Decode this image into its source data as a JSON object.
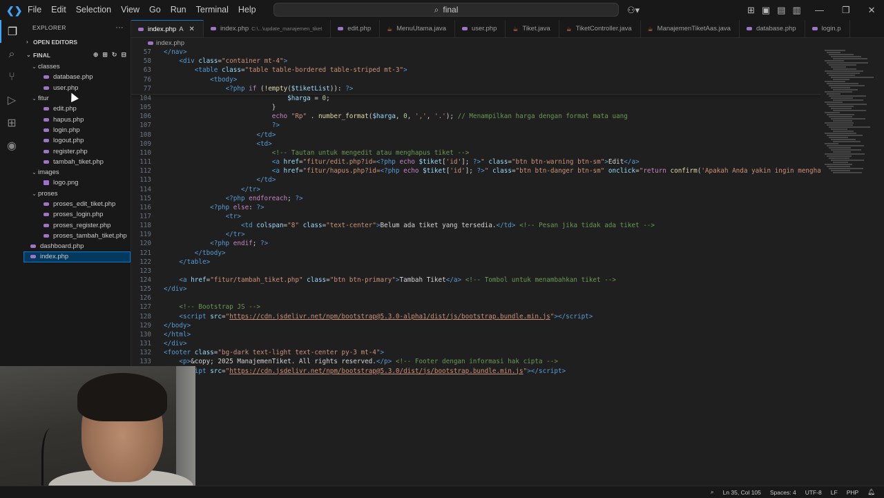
{
  "menu": [
    "File",
    "Edit",
    "Selection",
    "View",
    "Go",
    "Run",
    "Terminal",
    "Help"
  ],
  "search": {
    "text": "final"
  },
  "sidebar": {
    "header": "EXPLORER",
    "open_editors": "OPEN EDITORS",
    "folder": "FINAL",
    "tree": [
      {
        "label": "classes",
        "type": "folder",
        "depth": 1
      },
      {
        "label": "database.php",
        "type": "php",
        "depth": 2
      },
      {
        "label": "user.php",
        "type": "php",
        "depth": 2
      },
      {
        "label": "fitur",
        "type": "folder",
        "depth": 1
      },
      {
        "label": "edit.php",
        "type": "php",
        "depth": 2
      },
      {
        "label": "hapus.php",
        "type": "php",
        "depth": 2
      },
      {
        "label": "login.php",
        "type": "php",
        "depth": 2
      },
      {
        "label": "logout.php",
        "type": "php",
        "depth": 2
      },
      {
        "label": "register.php",
        "type": "php",
        "depth": 2
      },
      {
        "label": "tambah_tiket.php",
        "type": "php",
        "depth": 2
      },
      {
        "label": "images",
        "type": "folder",
        "depth": 1
      },
      {
        "label": "logo.png",
        "type": "img",
        "depth": 2
      },
      {
        "label": "proses",
        "type": "folder",
        "depth": 1
      },
      {
        "label": "proses_edit_tiket.php",
        "type": "php",
        "depth": 2
      },
      {
        "label": "proses_login.php",
        "type": "php",
        "depth": 2
      },
      {
        "label": "proses_register.php",
        "type": "php",
        "depth": 2
      },
      {
        "label": "proses_tambah_tiket.php",
        "type": "php",
        "depth": 2
      },
      {
        "label": "dashboard.php",
        "type": "php",
        "depth": 1
      },
      {
        "label": "index.php",
        "type": "php",
        "depth": 1,
        "selected": true
      }
    ]
  },
  "tabs": [
    {
      "label": "index.php",
      "modified": "A",
      "type": "php",
      "active": true
    },
    {
      "label": "index.php",
      "desc": "C:\\...\\update_manajemen_tiket",
      "type": "php"
    },
    {
      "label": "edit.php",
      "type": "php"
    },
    {
      "label": "MenuUtama.java",
      "type": "java"
    },
    {
      "label": "user.php",
      "type": "php"
    },
    {
      "label": "Tiket.java",
      "type": "java"
    },
    {
      "label": "TiketController.java",
      "type": "java"
    },
    {
      "label": "ManajemenTiketAas.java",
      "type": "java"
    },
    {
      "label": "database.php",
      "type": "php"
    },
    {
      "label": "login.p",
      "type": "php"
    }
  ],
  "breadcrumb": "index.php",
  "sticky_lines": [
    {
      "n": "57",
      "html": "<span class='t-tag'>&lt;/nav&gt;</span>"
    },
    {
      "n": "58",
      "html": "    <span class='t-tag'>&lt;div</span> <span class='t-attr'>class</span>=<span class='t-str'>\"container mt-4\"</span><span class='t-tag'>&gt;</span>"
    },
    {
      "n": "63",
      "html": "        <span class='t-tag'>&lt;table</span> <span class='t-attr'>class</span>=<span class='t-str'>\"table table-bordered table-striped mt-3\"</span><span class='t-tag'>&gt;</span>"
    },
    {
      "n": "76",
      "html": "            <span class='t-tag'>&lt;tbody&gt;</span>"
    },
    {
      "n": "77",
      "html": "                <span class='t-php'>&lt;?php</span> <span class='t-kw'>if</span> <span class='t-txt'>(!</span><span class='t-fn'>empty</span><span class='t-txt'>(</span><span class='t-var'>$tiketList</span><span class='t-txt'>)):</span> <span class='t-php'>?&gt;</span>"
    }
  ],
  "code_lines": [
    {
      "n": "104",
      "html": "                                <span class='t-var'>$harga</span> <span class='t-txt'>=</span> <span class='t-num'>0</span><span class='t-txt'>;</span>"
    },
    {
      "n": "105",
      "html": "                            <span class='t-txt'>}</span>"
    },
    {
      "n": "106",
      "html": "                            <span class='t-kw'>echo</span> <span class='t-str'>\"Rp\"</span> <span class='t-txt'>.</span> <span class='t-fn'>number_format</span><span class='t-txt'>(</span><span class='t-var'>$harga</span><span class='t-txt'>,</span> <span class='t-num'>0</span><span class='t-txt'>,</span> <span class='t-str'>','</span><span class='t-txt'>,</span> <span class='t-str'>'.'</span><span class='t-txt'>);</span> <span class='t-cmt'>// Menampilkan harga dengan format mata uang</span>"
    },
    {
      "n": "107",
      "html": "                            <span class='t-php'>?&gt;</span>"
    },
    {
      "n": "108",
      "html": "                        <span class='t-tag'>&lt;/td&gt;</span>"
    },
    {
      "n": "109",
      "html": "                        <span class='t-tag'>&lt;td&gt;</span>"
    },
    {
      "n": "110",
      "html": "                            <span class='t-cmt'>&lt;!-- Tautan untuk mengedit atau menghapus tiket --&gt;</span>"
    },
    {
      "n": "111",
      "html": "                            <span class='t-tag'>&lt;a</span> <span class='t-attr'>href</span>=<span class='t-str'>\"fitur/edit.php?id=</span><span class='t-php'>&lt;?php</span> <span class='t-kw'>echo</span> <span class='t-var'>$tiket</span><span class='t-txt'>[</span><span class='t-str'>'id'</span><span class='t-txt'>];</span> <span class='t-php'>?&gt;</span><span class='t-str'>\"</span> <span class='t-attr'>class</span>=<span class='t-str'>\"btn btn-warning btn-sm\"</span><span class='t-tag'>&gt;</span><span class='t-txt'>Edit</span><span class='t-tag'>&lt;/a&gt;</span>"
    },
    {
      "n": "112",
      "html": "                            <span class='t-tag'>&lt;a</span> <span class='t-attr'>href</span>=<span class='t-str'>\"fitur/hapus.php?id=</span><span class='t-php'>&lt;?php</span> <span class='t-kw'>echo</span> <span class='t-var'>$tiket</span><span class='t-txt'>[</span><span class='t-str'>'id'</span><span class='t-txt'>];</span> <span class='t-php'>?&gt;</span><span class='t-str'>\"</span> <span class='t-attr'>class</span>=<span class='t-str'>\"btn btn-danger btn-sm\"</span> <span class='t-attr'>onclick</span>=<span class='t-str'>\"</span><span class='t-kw'>return</span> <span class='t-fn'>confirm</span><span class='t-txt'>(</span><span class='t-str'>'Apakah Anda yakin ingin menghapus</span>"
    },
    {
      "n": "113",
      "html": "                        <span class='t-tag'>&lt;/td&gt;</span>"
    },
    {
      "n": "114",
      "html": "                    <span class='t-tag'>&lt;/tr&gt;</span>"
    },
    {
      "n": "115",
      "html": "                <span class='t-php'>&lt;?php</span> <span class='t-kw'>endforeach</span><span class='t-txt'>;</span> <span class='t-php'>?&gt;</span>"
    },
    {
      "n": "116",
      "html": "            <span class='t-php'>&lt;?php</span> <span class='t-kw'>else</span><span class='t-txt'>:</span> <span class='t-php'>?&gt;</span>"
    },
    {
      "n": "117",
      "html": "                <span class='t-tag'>&lt;tr&gt;</span>"
    },
    {
      "n": "118",
      "html": "                    <span class='t-tag'>&lt;td</span> <span class='t-attr'>colspan</span>=<span class='t-str'>\"8\"</span> <span class='t-attr'>class</span>=<span class='t-str'>\"text-center\"</span><span class='t-tag'>&gt;</span><span class='t-txt'>Belum ada tiket yang tersedia.</span><span class='t-tag'>&lt;/td&gt;</span> <span class='t-cmt'>&lt;!-- Pesan jika tidak ada tiket --&gt;</span>"
    },
    {
      "n": "119",
      "html": "                <span class='t-tag'>&lt;/tr&gt;</span>"
    },
    {
      "n": "120",
      "html": "            <span class='t-php'>&lt;?php</span> <span class='t-kw'>endif</span><span class='t-txt'>;</span> <span class='t-php'>?&gt;</span>"
    },
    {
      "n": "121",
      "html": "        <span class='t-tag'>&lt;/tbody&gt;</span>"
    },
    {
      "n": "122",
      "html": "    <span class='t-tag'>&lt;/table&gt;</span>"
    },
    {
      "n": "123",
      "html": ""
    },
    {
      "n": "124",
      "html": "    <span class='t-tag'>&lt;a</span> <span class='t-attr'>href</span>=<span class='t-str'>\"fitur/tambah_tiket.php\"</span> <span class='t-attr'>class</span>=<span class='t-str'>\"btn btn-primary\"</span><span class='t-tag'>&gt;</span><span class='t-txt'>Tambah Tiket</span><span class='t-tag'>&lt;/a&gt;</span> <span class='t-cmt'>&lt;!-- Tombol untuk menambahkan tiket --&gt;</span>"
    },
    {
      "n": "125",
      "html": "<span class='t-tag'>&lt;/div&gt;</span>"
    },
    {
      "n": "126",
      "html": ""
    },
    {
      "n": "127",
      "html": "    <span class='t-cmt'>&lt;!-- Bootstrap JS --&gt;</span>"
    },
    {
      "n": "128",
      "html": "    <span class='t-tag'>&lt;script</span> <span class='t-attr'>src</span>=<span class='t-str'>\"</span><span class='t-url'>https://cdn.jsdelivr.net/npm/bootstrap@5.3.0-alpha1/dist/js/bootstrap.bundle.min.js</span><span class='t-str'>\"</span><span class='t-tag'>&gt;&lt;/script&gt;</span>"
    },
    {
      "n": "129",
      "html": "<span class='t-tag'>&lt;/body&gt;</span>"
    },
    {
      "n": "130",
      "html": "<span class='t-tag'>&lt;/html&gt;</span>"
    },
    {
      "n": "131",
      "html": "<span class='t-tag'>&lt;/div&gt;</span>"
    },
    {
      "n": "132",
      "html": "<span class='t-tag'>&lt;footer</span> <span class='t-attr'>class</span>=<span class='t-str'>\"bg-dark text-light text-center py-3 mt-4\"</span><span class='t-tag'>&gt;</span>"
    },
    {
      "n": "133",
      "html": "    <span class='t-tag'>&lt;p&gt;</span><span class='t-txt'>&amp;copy; 2025 ManajemenTiket. All rights reserved.</span><span class='t-tag'>&lt;/p&gt;</span> <span class='t-cmt'>&lt;!-- Footer dengan informasi hak cipta --&gt;</span>"
    },
    {
      "n": "134",
      "html": "    <span class='t-tag'>&lt;script</span> <span class='t-attr'>src</span>=<span class='t-str'>\"</span><span class='t-url'>https://cdn.jsdelivr.net/npm/bootstrap@5.3.0/dist/js/bootstrap.bundle.min.js</span><span class='t-str'>\"</span><span class='t-tag'>&gt;&lt;/script&gt;</span>"
    }
  ],
  "statusbar": {
    "position": "Ln 35, Col 105",
    "spaces": "Spaces: 4",
    "encoding": "UTF-8",
    "eol": "LF",
    "language": "PHP"
  },
  "icons": {
    "logo": "vscode-icon",
    "search": "search-icon"
  }
}
